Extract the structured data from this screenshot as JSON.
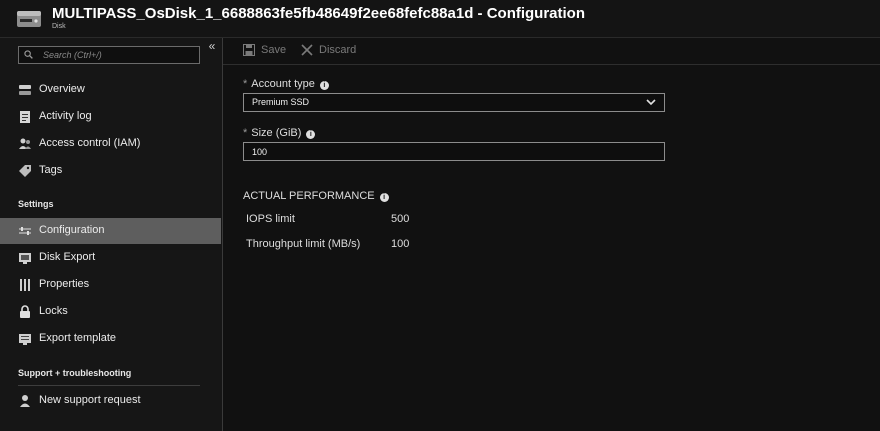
{
  "header": {
    "title": "MULTIPASS_OsDisk_1_6688863fe5fb48649f2ee68fefc88a1d - Configuration",
    "subtitle": "Disk",
    "icon": "disk-icon"
  },
  "sidebar": {
    "search_placeholder": "Search (Ctrl+/)",
    "collapse_glyph": "«",
    "items_top": [
      {
        "label": "Overview",
        "icon": "overview-icon"
      },
      {
        "label": "Activity log",
        "icon": "activity-log-icon"
      },
      {
        "label": "Access control (IAM)",
        "icon": "access-control-icon"
      },
      {
        "label": "Tags",
        "icon": "tag-icon"
      }
    ],
    "settings_header": "Settings",
    "settings_items": [
      {
        "label": "Configuration",
        "icon": "configuration-icon",
        "active": true
      },
      {
        "label": "Disk Export",
        "icon": "disk-export-icon"
      },
      {
        "label": "Properties",
        "icon": "properties-icon"
      },
      {
        "label": "Locks",
        "icon": "lock-icon"
      },
      {
        "label": "Export template",
        "icon": "export-template-icon"
      }
    ],
    "support_header": "Support + troubleshooting",
    "support_items": [
      {
        "label": "New support request",
        "icon": "support-request-icon"
      }
    ]
  },
  "toolbar": {
    "save_label": "Save",
    "discard_label": "Discard"
  },
  "form": {
    "account_type": {
      "required_mark": "*",
      "label": "Account type",
      "value": "Premium SSD"
    },
    "size": {
      "required_mark": "*",
      "label": "Size (GiB)",
      "value": "100"
    },
    "performance": {
      "heading": "ACTUAL PERFORMANCE",
      "iops_label": "IOPS limit",
      "iops_value": "500",
      "throughput_label": "Throughput limit (MB/s)",
      "throughput_value": "100"
    }
  },
  "colors": {
    "background": "#111111",
    "active_item": "#5e5e5e",
    "text": "#e6e6e6"
  }
}
